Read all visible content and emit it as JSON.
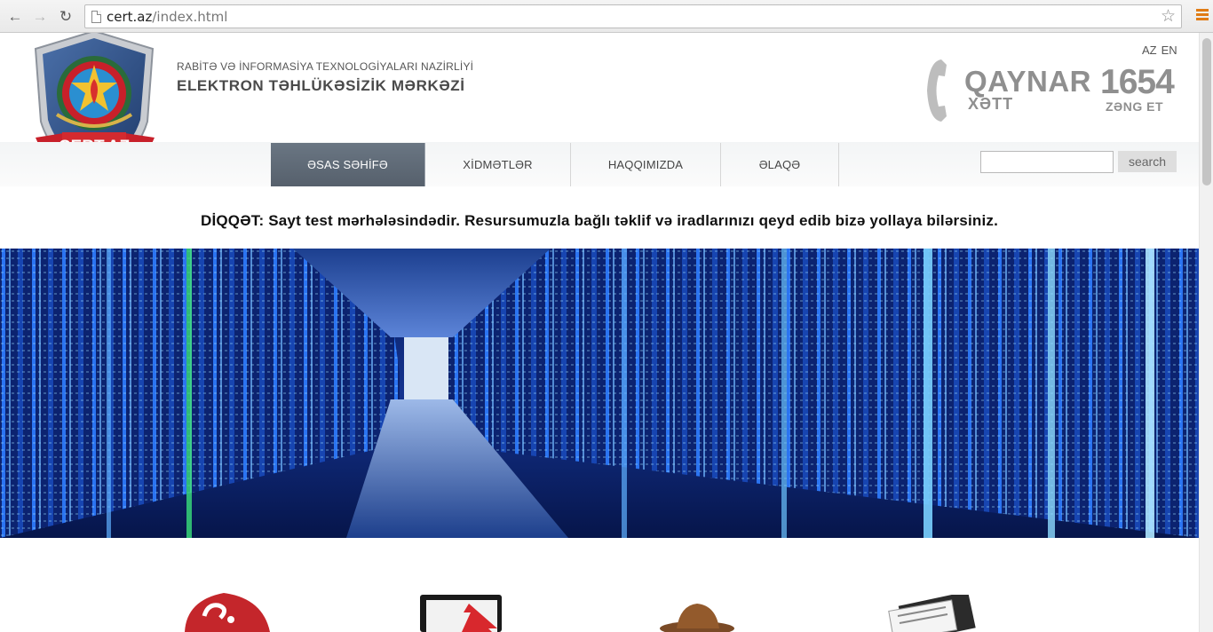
{
  "browser": {
    "url_host": "cert.az",
    "url_path": "/index.html"
  },
  "header": {
    "logo_text": "CERT.AZ",
    "ministry": "RABİTƏ VƏ İNFORMASİYA TEXNOLOGİYALARI NAZİRLİYİ",
    "center_name": "ELEKTRON TƏHLÜKƏSİZİK MƏRKƏZİ",
    "languages": [
      "AZ",
      "EN"
    ]
  },
  "hotline": {
    "title": "QAYNAR",
    "subtitle": "XƏTT",
    "number": "1654",
    "call": "ZƏNG ET"
  },
  "nav": {
    "items": [
      {
        "label": "ƏSAS SƏHİFƏ",
        "active": true
      },
      {
        "label": "XİDMƏTLƏR",
        "active": false
      },
      {
        "label": "HAQQIMIZDA",
        "active": false
      },
      {
        "label": "ƏLAQƏ",
        "active": false
      }
    ],
    "search_button": "search",
    "search_value": ""
  },
  "notice": "DİQQƏT: Sayt test mərhələsindədir. Resursumuzla bağlı təklif və iradlarınızı qeyd edib bizə yollaya bilərsiniz.",
  "colors": {
    "nav_active": "#5e6874",
    "hotline_gray": "#8f8f8f",
    "logo_red": "#c8202a",
    "logo_blue": "#2c4f86"
  }
}
